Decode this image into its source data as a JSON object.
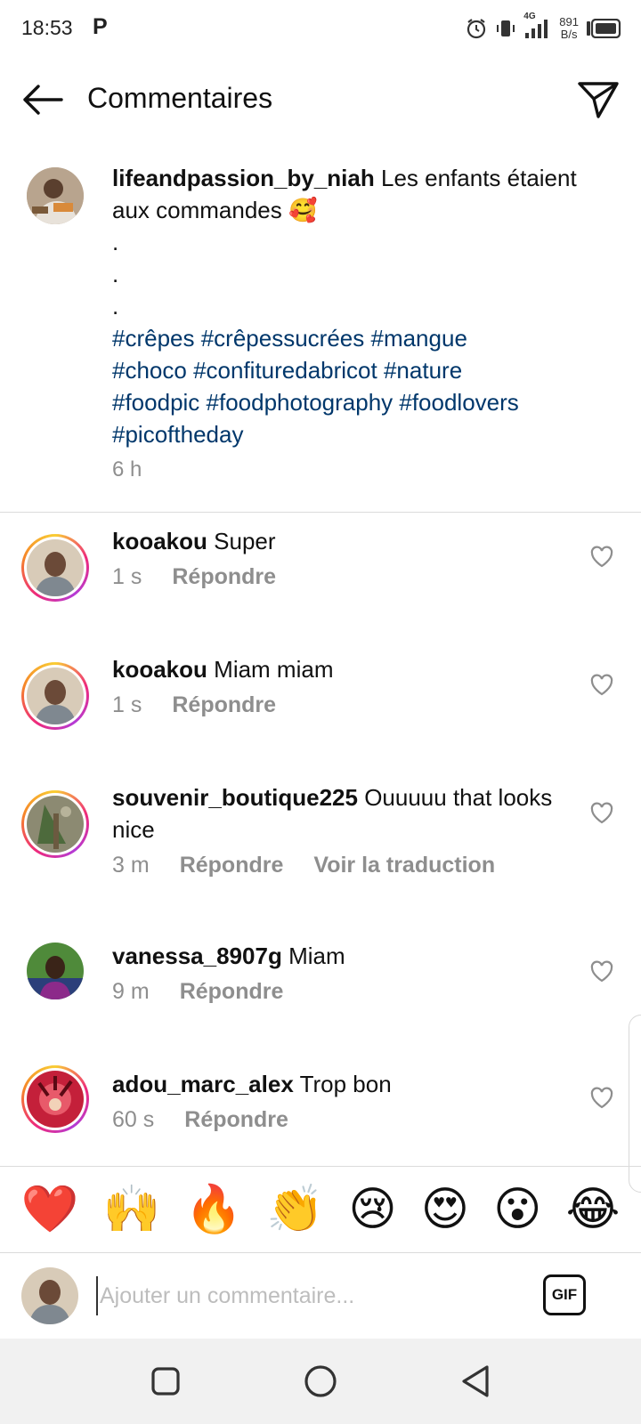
{
  "status_bar": {
    "time": "18:53",
    "notification_app": "P",
    "network_type": "4G",
    "speed_value": "891",
    "speed_unit": "B/s"
  },
  "header": {
    "title": "Commentaires"
  },
  "post": {
    "username": "lifeandpassion_by_niah",
    "caption_text": "Les enfants étaient aux commandes 🥰",
    "dots": [
      ".",
      ".",
      "."
    ],
    "hashtag_lines": [
      "#crêpes #crêpessucrées #mangue",
      "#choco #confituredabricot #nature",
      "#foodpic #foodphotography #foodlovers",
      "#picoftheday"
    ],
    "time": "6 h"
  },
  "comments": [
    {
      "username": "kooakou",
      "text": "Super",
      "time": "1 s",
      "reply": "Répondre",
      "translate": ""
    },
    {
      "username": "kooakou",
      "text": "Miam miam",
      "time": "1 s",
      "reply": "Répondre",
      "translate": ""
    },
    {
      "username": "souvenir_boutique225",
      "text": "Ouuuuu that looks nice",
      "time": "3 m",
      "reply": "Répondre",
      "translate": "Voir la traduction"
    },
    {
      "username": "vanessa_8907g",
      "text": "Miam",
      "time": "9 m",
      "reply": "Répondre",
      "translate": ""
    },
    {
      "username": "adou_marc_alex",
      "text": "Trop bon",
      "time": "60 s",
      "reply": "Répondre",
      "translate": ""
    }
  ],
  "emoji_bar": [
    "❤️",
    "🙌",
    "🔥",
    "👏",
    "😢",
    "😍",
    "😮",
    "😂"
  ],
  "composer": {
    "placeholder": "Ajouter un commentaire...",
    "gif_label": "GIF"
  },
  "colors": {
    "hashtag": "#00376b",
    "meta_grey": "#8e8e8e",
    "divider": "#dbdbdb"
  }
}
